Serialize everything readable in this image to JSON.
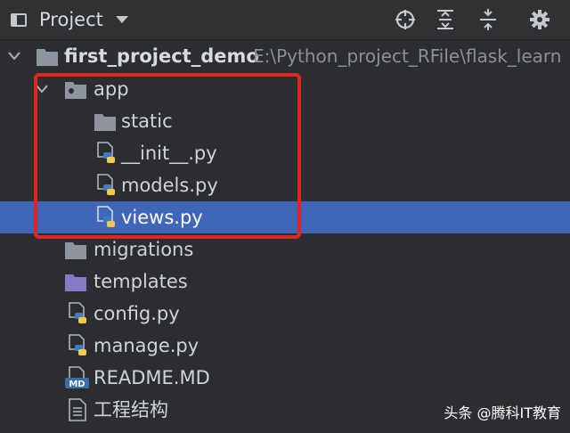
{
  "toolbar": {
    "title": "Project",
    "dropdown_icon": "caret-down-icon",
    "buttons": [
      "locate-icon",
      "expand-all-icon",
      "collapse-all-icon",
      "settings-gear-icon"
    ]
  },
  "tree": {
    "root": {
      "label": "first_project_demo",
      "path": "E:\\Python_project_RFile\\flask_learn"
    },
    "app": {
      "label": "app"
    },
    "static": {
      "label": "static"
    },
    "init": {
      "label": "__init__.py"
    },
    "models": {
      "label": "models.py"
    },
    "views": {
      "label": "views.py"
    },
    "migrations": {
      "label": "migrations"
    },
    "templates": {
      "label": "templates"
    },
    "config": {
      "label": "config.py"
    },
    "manage": {
      "label": "manage.py"
    },
    "readme": {
      "label": "README.MD",
      "badge": "MD"
    },
    "structure": {
      "label": "工程结构"
    }
  },
  "watermark": {
    "text": "头条 @腾科IT教育"
  },
  "colors": {
    "background": "#2b2d30",
    "selection": "#3f66b8",
    "highlight_box": "#e0271f",
    "folder": "#8f959c",
    "templates_folder": "#8a78c6"
  }
}
